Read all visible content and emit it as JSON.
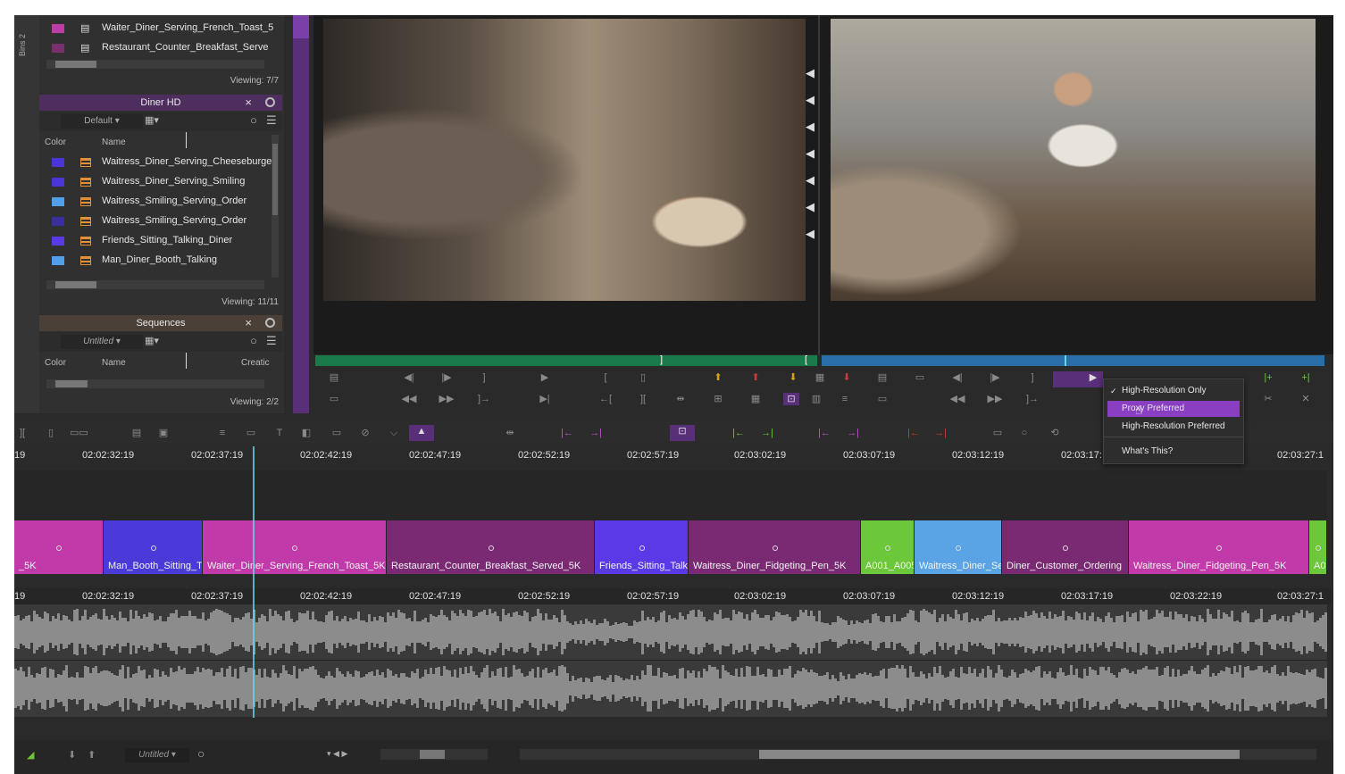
{
  "bins_tab": "Bins 2",
  "top_bin": {
    "items": [
      {
        "name": "Waiter_Diner_Serving_French_Toast_5",
        "color": "#c03aa8"
      },
      {
        "name": "Restaurant_Counter_Breakfast_Serve",
        "color": "#7a2f6e"
      }
    ],
    "viewing": "Viewing: 7/7"
  },
  "diner_hd": {
    "title": "Diner HD",
    "view": "Default",
    "col_color": "Color",
    "col_name": "Name",
    "items": [
      {
        "name": "Waitress_Diner_Serving_Cheeseburge",
        "color": "#4a36d6"
      },
      {
        "name": "Waitress_Diner_Serving_Smiling",
        "color": "#4a36d6"
      },
      {
        "name": "Waitress_Smiling_Serving_Order",
        "color": "#4fa0e8"
      },
      {
        "name": "Waitress_Smiling_Serving_Order",
        "color": "#3a2fa0"
      },
      {
        "name": "Friends_Sitting_Talking_Diner",
        "color": "#5a3ae6"
      },
      {
        "name": "Man_Diner_Booth_Talking",
        "color": "#4fa0e8"
      }
    ],
    "viewing": "Viewing: 11/11"
  },
  "sequences": {
    "title": "Sequences",
    "view": "Untitled",
    "col_color": "Color",
    "col_name": "Name",
    "col_creation": "Creatic",
    "viewing": "Viewing: 2/2"
  },
  "context_menu": {
    "items": [
      {
        "label": "High-Resolution Only",
        "checked": true
      },
      {
        "label": "Proxy Preferred",
        "selected": true
      },
      {
        "label": "High-Resolution Preferred"
      },
      {
        "label": "What's This?"
      }
    ]
  },
  "ruler_top": [
    "19",
    "02:02:32:19",
    "02:02:37:19",
    "02:02:42:19",
    "02:02:47:19",
    "02:02:52:19",
    "02:02:57:19",
    "02:03:02:19",
    "02:03:07:19",
    "02:03:12:19",
    "02:03:17:",
    "02:03:27:1"
  ],
  "ruler_bottom": [
    "19",
    "02:02:32:19",
    "02:02:37:19",
    "02:02:42:19",
    "02:02:47:19",
    "02:02:52:19",
    "02:02:57:19",
    "02:03:02:19",
    "02:03:07:19",
    "02:03:12:19",
    "02:03:17:19",
    "02:03:22:19",
    "02:03:27:1"
  ],
  "clips": [
    {
      "name": "_5K",
      "color": "#c13aa9"
    },
    {
      "name": "Man_Booth_Sitting_T",
      "color": "#4a3ad8"
    },
    {
      "name": "Waiter_Diner_Serving_French_Toast_5K",
      "color": "#c13aa9"
    },
    {
      "name": "Restaurant_Counter_Breakfast_Served_5K",
      "color": "#7a2a72"
    },
    {
      "name": "Friends_Sitting_Talk",
      "color": "#5a3ae6"
    },
    {
      "name": "Waitress_Diner_Fidgeting_Pen_5K",
      "color": "#7a2a72"
    },
    {
      "name": "A001_A005",
      "color": "#6cc73a"
    },
    {
      "name": "Waitress_Diner_Se",
      "color": "#5aa4e6"
    },
    {
      "name": "Diner_Customer_Ordering",
      "color": "#7a2a72"
    },
    {
      "name": "Waitress_Diner_Fidgeting_Pen_5K",
      "color": "#c13aa9"
    },
    {
      "name": "A0",
      "color": "#6cc73a"
    }
  ],
  "footer": {
    "sequence": "Untitled"
  }
}
